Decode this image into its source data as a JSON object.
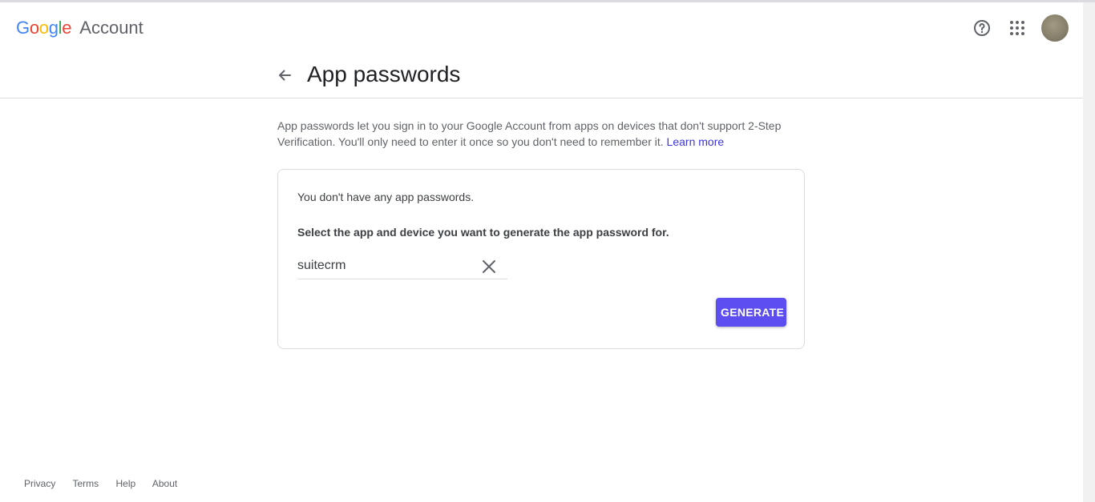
{
  "header": {
    "logo_google_letters": [
      "G",
      "o",
      "o",
      "g",
      "l",
      "e"
    ],
    "logo_google_colors": [
      "#4285F4",
      "#EA4335",
      "#FBBC05",
      "#4285F4",
      "#34A853",
      "#EA4335"
    ],
    "logo_account": "Account",
    "help_icon": "help-circle-icon",
    "apps_icon": "apps-grid-icon"
  },
  "page": {
    "back_icon": "arrow-back-icon",
    "title": "App passwords",
    "description": "App passwords let you sign in to your Google Account from apps on devices that don't support 2-Step Verification. You'll only need to enter it once so you don't need to remember it.",
    "learn_more": "Learn more"
  },
  "card": {
    "no_passwords_text": "You don't have any app passwords.",
    "select_label": "Select the app and device you want to generate the app password for.",
    "app_field_value": "suitecrm",
    "clear_icon": "close-icon",
    "generate_label": "GENERATE"
  },
  "footer": {
    "links": [
      "Privacy",
      "Terms",
      "Help",
      "About"
    ]
  },
  "colors": {
    "accent": "#5c4ef0",
    "link": "#3c34d9"
  }
}
